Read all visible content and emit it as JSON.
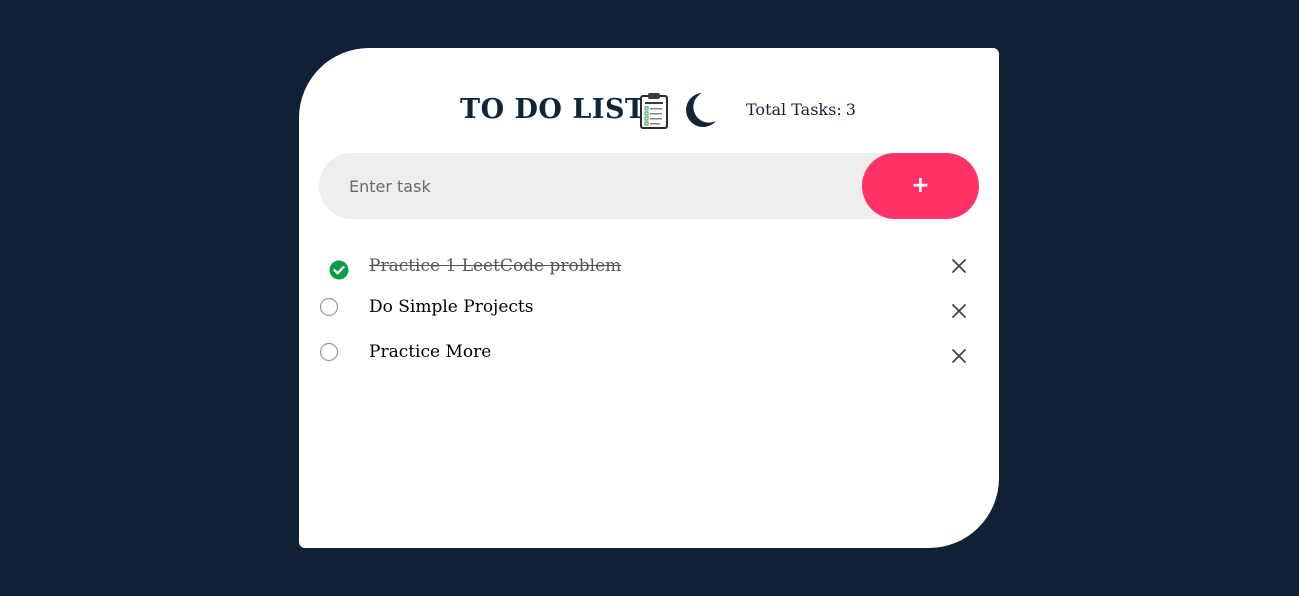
{
  "header": {
    "title": "TO DO LIST",
    "clipboard_icon": "clipboard-checklist-icon",
    "theme_icon": "moon-icon",
    "total_label": "Total Tasks:",
    "total_count": "3"
  },
  "input": {
    "placeholder": "Enter task",
    "value": "",
    "add_label": "+"
  },
  "tasks": [
    {
      "text": "Practice 1 LeetCode problem",
      "completed": true
    },
    {
      "text": "Do Simple Projects",
      "completed": false
    },
    {
      "text": "Practice More",
      "completed": false
    }
  ],
  "colors": {
    "background": "#112135",
    "card": "#ffffff",
    "accent": "#ff3367",
    "done_check": "#0a9c4a",
    "title": "#0f2538"
  }
}
